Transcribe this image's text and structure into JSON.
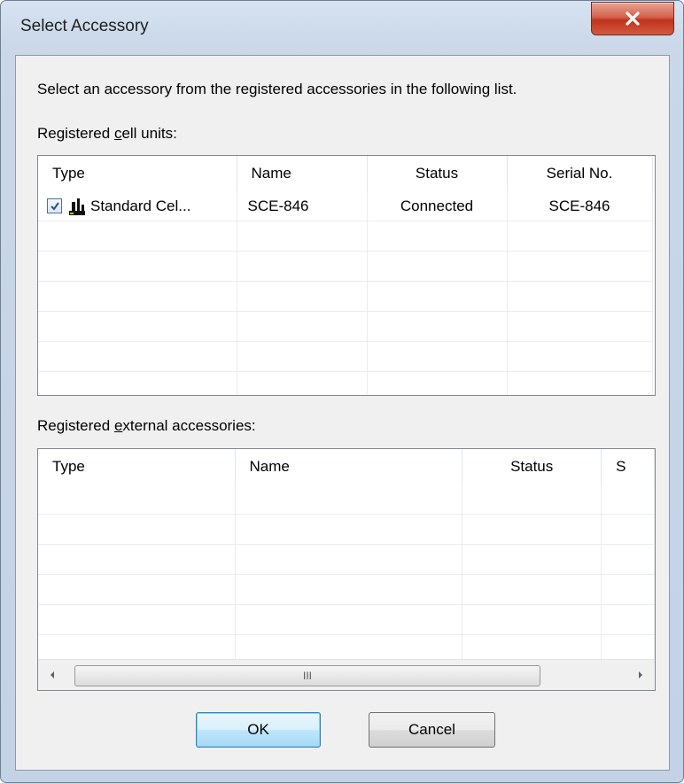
{
  "window": {
    "title": "Select Accessory"
  },
  "instruction": "Select an accessory from the registered accessories in the following list.",
  "cell_units": {
    "label_pre": "Registered ",
    "label_mnemonic": "c",
    "label_post": "ell units:",
    "columns": [
      "Type",
      "Name",
      "Status",
      "Serial No."
    ],
    "rows": [
      {
        "checked": true,
        "icon": "cell-unit-icon",
        "type": "Standard Cel...",
        "name": "SCE-846",
        "status": "Connected",
        "serial": "SCE-846"
      }
    ]
  },
  "external": {
    "label_pre": "Registered ",
    "label_mnemonic": "e",
    "label_post": "xternal accessories:",
    "columns": [
      "Type",
      "Name",
      "Status",
      "S"
    ],
    "rows": [],
    "scrollbar": {
      "grip": "III"
    }
  },
  "buttons": {
    "ok": "OK",
    "cancel": "Cancel"
  }
}
